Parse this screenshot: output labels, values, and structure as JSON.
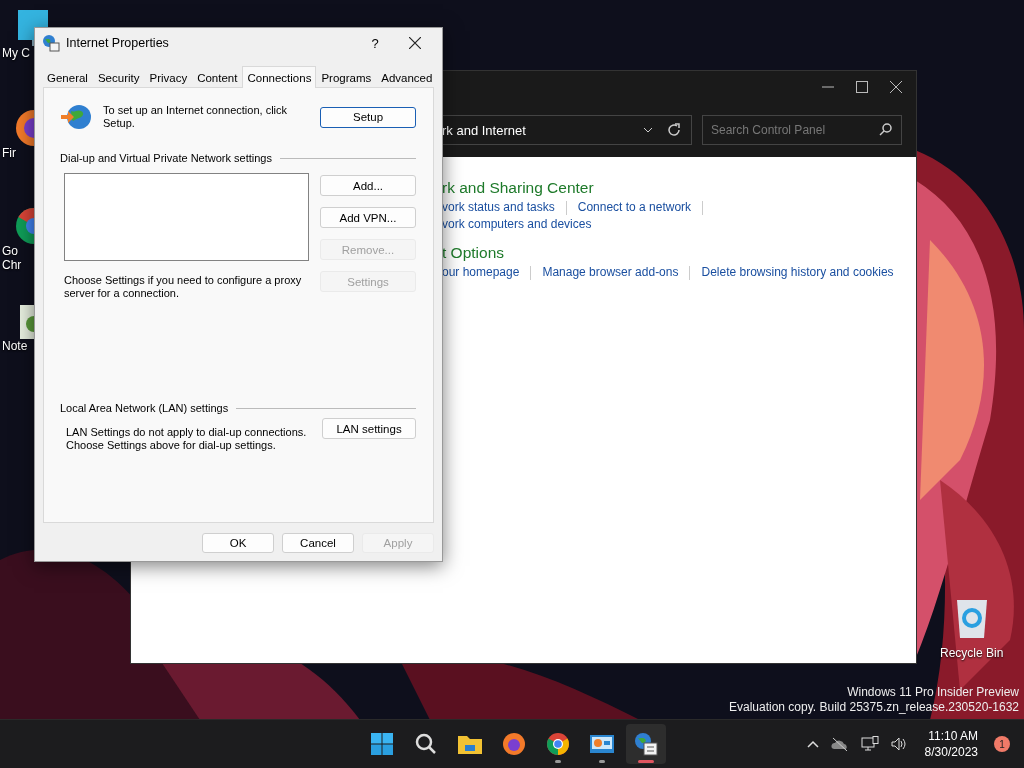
{
  "desktop_icons": [
    {
      "kind": "computer",
      "lines": [
        "My C"
      ]
    },
    {
      "kind": "firefox",
      "lines": [
        "Fir"
      ]
    },
    {
      "kind": "chrome",
      "lines": [
        "Go",
        "Chr"
      ]
    },
    {
      "kind": "notepad",
      "lines": [
        "Note"
      ]
    }
  ],
  "recycle_bin": {
    "label": "Recycle Bin"
  },
  "control_panel": {
    "address": "rk and Internet",
    "search": {
      "placeholder": "Search Control Panel"
    },
    "sections": [
      {
        "title": "rk and Sharing Center",
        "rows": [
          {
            "links": [
              "vork status and tasks",
              "Connect to a network"
            ],
            "trailing_separator": true
          },
          {
            "links": [
              "vork computers and devices"
            ],
            "trailing_separator": false
          }
        ]
      },
      {
        "title": "t Options",
        "rows": [
          {
            "links": [
              "our homepage",
              "Manage browser add-ons",
              "Delete browsing history and cookies"
            ],
            "trailing_separator": false
          }
        ]
      }
    ]
  },
  "dialog": {
    "title": "Internet Properties",
    "help": "?",
    "tabs": [
      {
        "label": "General",
        "selected": false
      },
      {
        "label": "Security",
        "selected": false
      },
      {
        "label": "Privacy",
        "selected": false
      },
      {
        "label": "Content",
        "selected": false
      },
      {
        "label": "Connections",
        "selected": true
      },
      {
        "label": "Programs",
        "selected": false
      },
      {
        "label": "Advanced",
        "selected": false
      }
    ],
    "intro": "To set up an Internet connection, click Setup.",
    "setup_button": "Setup",
    "vpn_section": "Dial-up and Virtual Private Network settings",
    "vpn_buttons": [
      {
        "label": "Add...",
        "disabled": false
      },
      {
        "label": "Add VPN...",
        "disabled": false
      },
      {
        "label": "Remove...",
        "disabled": true
      },
      {
        "label": "Settings",
        "disabled": true
      }
    ],
    "proxy_note": "Choose Settings if you need to configure a proxy server for a connection.",
    "lan_section": "Local Area Network (LAN) settings",
    "lan_note": "LAN Settings do not apply to dial-up connections. Choose Settings above for dial-up settings.",
    "lan_button": "LAN settings",
    "footer_buttons": [
      {
        "label": "OK",
        "disabled": false
      },
      {
        "label": "Cancel",
        "disabled": false
      },
      {
        "label": "Apply",
        "disabled": true
      }
    ]
  },
  "watermark_lines": [
    "Windows 11 Pro Insider Preview",
    "Evaluation copy. Build 25375.zn_release.230520-1632"
  ],
  "taskbar": {
    "apps": [
      {
        "kind": "start",
        "running": false,
        "selected": false
      },
      {
        "kind": "search",
        "running": false,
        "selected": false
      },
      {
        "kind": "explorer",
        "running": false,
        "selected": false
      },
      {
        "kind": "firefox",
        "running": false,
        "selected": false
      },
      {
        "kind": "chrome",
        "running": true,
        "selected": false
      },
      {
        "kind": "control-panel",
        "running": true,
        "selected": false
      },
      {
        "kind": "internet-options",
        "running": true,
        "selected": true
      }
    ],
    "time": "11:10 AM",
    "date": "8/30/2023",
    "notifications": "1"
  }
}
